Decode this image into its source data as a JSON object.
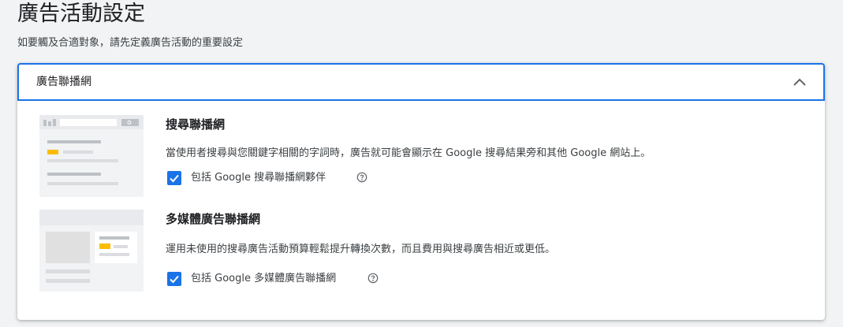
{
  "page": {
    "title": "廣告活動設定",
    "subtitle": "如要觸及合適對象，請先定義廣告活動的重要設定"
  },
  "networks_panel": {
    "header_label": "廣告聯播網",
    "expanded": true,
    "accent_color": "#1a73e8",
    "sections": [
      {
        "title": "搜尋聯播網",
        "description": "當使用者搜尋與您關鍵字相關的字詞時，廣告就可能會顯示在 Google 搜尋結果旁和其他 Google 網站上。",
        "checkbox_label": "包括 Google 搜尋聯播網夥伴",
        "checked": true,
        "illustration": "search-results-page-illustration"
      },
      {
        "title": "多媒體廣告聯播網",
        "description": "運用未使用的搜尋廣告活動預算輕鬆提升轉換次數，而且費用與搜尋廣告相近或更低。",
        "checkbox_label": "包括 Google 多媒體廣告聯播網",
        "checked": true,
        "illustration": "display-webpage-illustration"
      }
    ]
  }
}
